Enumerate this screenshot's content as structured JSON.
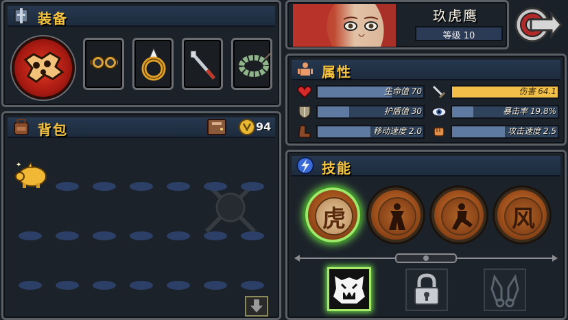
{
  "equipment": {
    "title": "装备",
    "slots": [
      "weapon-knuckle",
      "goggles",
      "ring",
      "blade",
      "bead-bracelet"
    ]
  },
  "character": {
    "name": "玖虎鹰",
    "level_label": "等级 10"
  },
  "attributes": {
    "title": "属性",
    "stats": [
      {
        "key": "hp",
        "label": "生命值 70",
        "icon": "heart-icon",
        "fill": 0.7
      },
      {
        "key": "dmg",
        "label": "伤害 64.1",
        "icon": "sword-icon",
        "fill": 1.0
      },
      {
        "key": "shield",
        "label": "护盾值 30",
        "icon": "shield-icon",
        "fill": 0.3
      },
      {
        "key": "crit",
        "label": "暴击率 19.8%",
        "icon": "eye-icon",
        "fill": 0.2
      },
      {
        "key": "move",
        "label": "移动速度 2.0",
        "icon": "boot-icon",
        "fill": 0.5
      },
      {
        "key": "atkspd",
        "label": "攻击速度 2.5",
        "icon": "fist-icon",
        "fill": 0.5
      }
    ]
  },
  "backpack": {
    "title": "背包",
    "coins": "94"
  },
  "skills": {
    "title": "技能",
    "items": [
      {
        "glyph": "虎",
        "selected": true
      },
      {
        "glyph": "",
        "selected": false
      },
      {
        "glyph": "",
        "selected": false
      },
      {
        "glyph": "风",
        "selected": false
      }
    ]
  },
  "colors": {
    "gold": "#f5c342",
    "header": "#26384f",
    "selected_glow": "#6fdc4a"
  }
}
